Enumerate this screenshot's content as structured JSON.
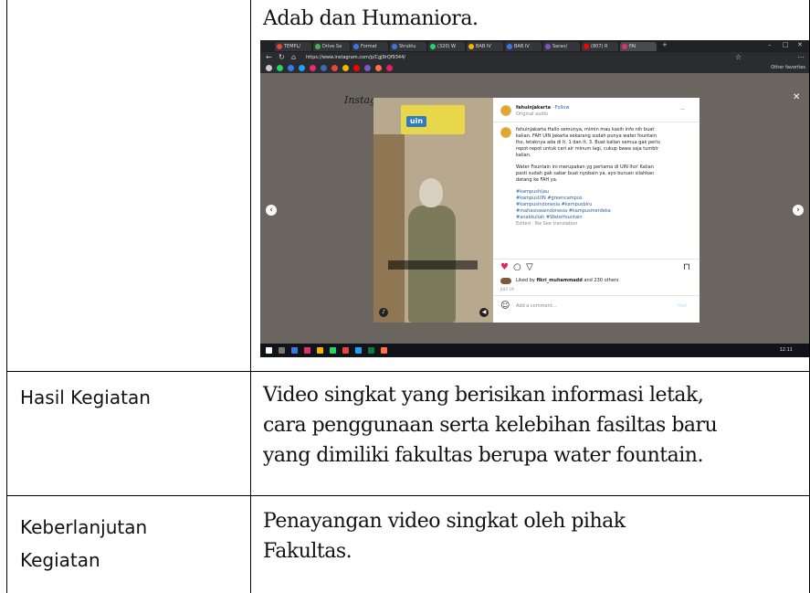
{
  "table": {
    "top_text": "Adab dan Humaniora.",
    "rows": [
      {
        "label": "Hasil Kegiatan",
        "lines": [
          "Video singkat yang berisikan informasi letak,",
          "cara penggunaan serta kelebihan fasiltas baru",
          "yang dimiliki fakultas berupa water fountain."
        ]
      },
      {
        "label_lines": [
          "Keberlanjutan",
          "Kegiatan"
        ],
        "lines": [
          "Penayangan video singkat oleh pihak",
          "Fakultas."
        ]
      }
    ]
  },
  "screenshot": {
    "tabs": [
      "TEMPL/",
      "Drive Sa",
      "Format",
      "Struktu",
      "(320) W",
      "BAB IV",
      "BAB IV",
      "Saran/",
      "(807) R",
      "FAI"
    ],
    "url": "https://www.instagram.com/p/CgJ9rQf9344/",
    "other_favorites": "Other favorites",
    "ig_logo": "Instagram",
    "post": {
      "username": "fahuinjakarta",
      "follow": "Follow",
      "audio": "Original audio",
      "caption_lines": [
        "fahuinjakarta Hallo semunya, mimin mau kasih info nih buat",
        "kalian. FAH UIN Jakarta sekarang sudah punya water fountain",
        "lho, letaknya ada di lt. 1 dan lt. 3. Buat kalian semua gak perlu",
        "repot-repot untuk cari air minum lagi, cukup bawa saja tumblr",
        "kalian."
      ],
      "caption2_lines": [
        "Water Fountain ini merupakan yg pertama di UIN lho! Kalian",
        "pasti sudah gak sabar buat nyobain ya, ayo buruan silahkan",
        "datang ke FAH ya."
      ],
      "hashtags": [
        "#kampushijau",
        "#kampusUIN #greencampus",
        "#kampusIndonesia #kampusbiru",
        "#mahasiswaindonesia #kampusmerdeka",
        "#anakkuliah #Waterfountain"
      ],
      "edited": "Edited · 8w   See translation",
      "liked_by_prefix": "Liked by",
      "liked_by_user": "fikri_muhammadd",
      "liked_by_suffix": "and 230 others",
      "date": "JULY 19",
      "comment_placeholder": "Add a comment...",
      "post_button": "Post"
    },
    "clock": "12:11"
  }
}
